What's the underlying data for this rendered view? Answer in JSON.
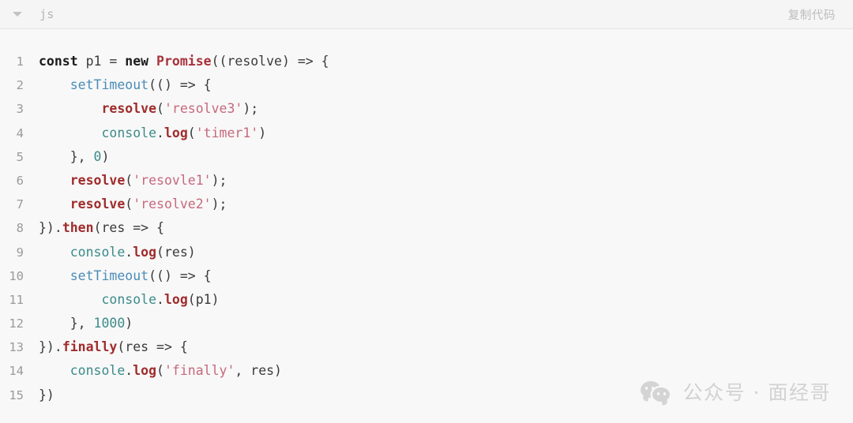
{
  "header": {
    "collapse_icon": "chevron-down-icon",
    "language": "js",
    "copy_label": "复制代码"
  },
  "watermark": {
    "icon": "wechat-icon",
    "text": "公众号 · 面经哥"
  },
  "code": {
    "language": "javascript",
    "line_count": 15,
    "plain_text": "const p1 = new Promise((resolve) => {\n    setTimeout(() => {\n        resolve('resolve3');\n        console.log('timer1')\n    }, 0)\n    resolve('resovle1');\n    resolve('resolve2');\n}).then(res => {\n    console.log(res)\n    setTimeout(() => {\n        console.log(p1)\n    }, 1000)\n}).finally(res => {\n    console.log('finally', res)\n})",
    "lines": [
      {
        "n": "1",
        "tokens": [
          {
            "t": "const",
            "c": "t-kw"
          },
          {
            "t": " p1 = ",
            "c": "t-plain"
          },
          {
            "t": "new",
            "c": "t-kw"
          },
          {
            "t": " ",
            "c": "t-plain"
          },
          {
            "t": "Promise",
            "c": "t-cls"
          },
          {
            "t": "((resolve) => {",
            "c": "t-plain"
          }
        ]
      },
      {
        "n": "2",
        "tokens": [
          {
            "t": "    ",
            "c": "t-plain"
          },
          {
            "t": "setTimeout",
            "c": "t-builtin"
          },
          {
            "t": "(() => {",
            "c": "t-plain"
          }
        ]
      },
      {
        "n": "3",
        "tokens": [
          {
            "t": "        ",
            "c": "t-plain"
          },
          {
            "t": "resolve",
            "c": "t-fn"
          },
          {
            "t": "(",
            "c": "t-plain"
          },
          {
            "t": "'resolve3'",
            "c": "t-str"
          },
          {
            "t": ");",
            "c": "t-plain"
          }
        ]
      },
      {
        "n": "4",
        "tokens": [
          {
            "t": "        ",
            "c": "t-plain"
          },
          {
            "t": "console",
            "c": "t-obj"
          },
          {
            "t": ".",
            "c": "t-plain"
          },
          {
            "t": "log",
            "c": "t-fn"
          },
          {
            "t": "(",
            "c": "t-plain"
          },
          {
            "t": "'timer1'",
            "c": "t-str"
          },
          {
            "t": ")",
            "c": "t-plain"
          }
        ]
      },
      {
        "n": "5",
        "tokens": [
          {
            "t": "    }, ",
            "c": "t-plain"
          },
          {
            "t": "0",
            "c": "t-num"
          },
          {
            "t": ")",
            "c": "t-plain"
          }
        ]
      },
      {
        "n": "6",
        "tokens": [
          {
            "t": "    ",
            "c": "t-plain"
          },
          {
            "t": "resolve",
            "c": "t-fn"
          },
          {
            "t": "(",
            "c": "t-plain"
          },
          {
            "t": "'resovle1'",
            "c": "t-str"
          },
          {
            "t": ");",
            "c": "t-plain"
          }
        ]
      },
      {
        "n": "7",
        "tokens": [
          {
            "t": "    ",
            "c": "t-plain"
          },
          {
            "t": "resolve",
            "c": "t-fn"
          },
          {
            "t": "(",
            "c": "t-plain"
          },
          {
            "t": "'resolve2'",
            "c": "t-str"
          },
          {
            "t": ");",
            "c": "t-plain"
          }
        ]
      },
      {
        "n": "8",
        "tokens": [
          {
            "t": "}).",
            "c": "t-plain"
          },
          {
            "t": "then",
            "c": "t-fn"
          },
          {
            "t": "(res => {",
            "c": "t-plain"
          }
        ]
      },
      {
        "n": "9",
        "tokens": [
          {
            "t": "    ",
            "c": "t-plain"
          },
          {
            "t": "console",
            "c": "t-obj"
          },
          {
            "t": ".",
            "c": "t-plain"
          },
          {
            "t": "log",
            "c": "t-fn"
          },
          {
            "t": "(res)",
            "c": "t-plain"
          }
        ]
      },
      {
        "n": "10",
        "tokens": [
          {
            "t": "    ",
            "c": "t-plain"
          },
          {
            "t": "setTimeout",
            "c": "t-builtin"
          },
          {
            "t": "(() => {",
            "c": "t-plain"
          }
        ]
      },
      {
        "n": "11",
        "tokens": [
          {
            "t": "        ",
            "c": "t-plain"
          },
          {
            "t": "console",
            "c": "t-obj"
          },
          {
            "t": ".",
            "c": "t-plain"
          },
          {
            "t": "log",
            "c": "t-fn"
          },
          {
            "t": "(p1)",
            "c": "t-plain"
          }
        ]
      },
      {
        "n": "12",
        "tokens": [
          {
            "t": "    }, ",
            "c": "t-plain"
          },
          {
            "t": "1000",
            "c": "t-num"
          },
          {
            "t": ")",
            "c": "t-plain"
          }
        ]
      },
      {
        "n": "13",
        "tokens": [
          {
            "t": "}).",
            "c": "t-plain"
          },
          {
            "t": "finally",
            "c": "t-fn"
          },
          {
            "t": "(res => {",
            "c": "t-plain"
          }
        ]
      },
      {
        "n": "14",
        "tokens": [
          {
            "t": "    ",
            "c": "t-plain"
          },
          {
            "t": "console",
            "c": "t-obj"
          },
          {
            "t": ".",
            "c": "t-plain"
          },
          {
            "t": "log",
            "c": "t-fn"
          },
          {
            "t": "(",
            "c": "t-plain"
          },
          {
            "t": "'finally'",
            "c": "t-str"
          },
          {
            "t": ", res)",
            "c": "t-plain"
          }
        ]
      },
      {
        "n": "15",
        "tokens": [
          {
            "t": "})",
            "c": "t-plain"
          }
        ]
      }
    ]
  },
  "colors": {
    "page_background": "#f8f8f8",
    "header_background": "#f5f5f5",
    "header_border": "#e4e4e4",
    "line_number": "#9a9a9a",
    "text_default": "#3a3a3a",
    "keyword": "#1b1b1b",
    "class_name": "#a8323b",
    "function_name": "#a02c2c",
    "builtin": "#4a8cb8",
    "object": "#3c8a8a",
    "string": "#c7687b",
    "number": "#3c8a8a",
    "muted": "#bdbdbd",
    "watermark": "#d2d2d2"
  }
}
